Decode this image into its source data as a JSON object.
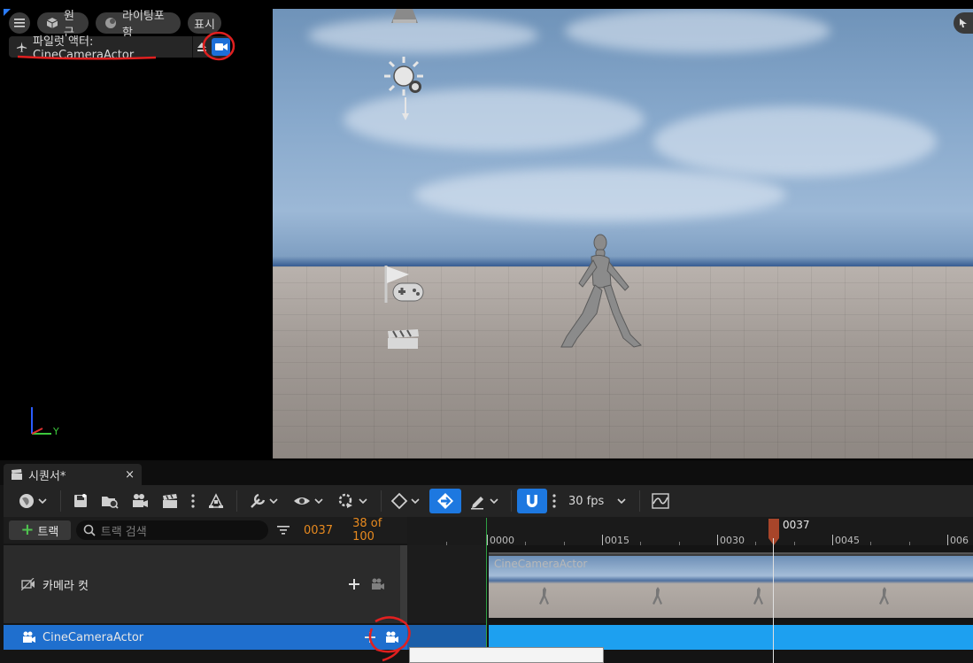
{
  "viewport": {
    "perspective_label": "원근",
    "lighting_label": "라이팅포함",
    "show_label": "표시",
    "pilot_label": "파일럿 액터: CineCameraActor",
    "axis_y_label": "Y"
  },
  "sequencer": {
    "tab_title": "시퀀서*",
    "close_glyph": "×",
    "add_track_label": "트랙",
    "search_placeholder": "트랙 검색",
    "current_frame": "0037",
    "frame_count": "38 of 100",
    "fps_label": "30 fps",
    "playhead_label": "0037",
    "ruler_labels": [
      "0000",
      "0015",
      "0030",
      "0045",
      "006"
    ],
    "tracks": {
      "camera_cut": "카메라 컷",
      "cine_camera": "CineCameraActor",
      "section_label": "CineCameraActor"
    }
  },
  "colors": {
    "accent": "#1d78e0",
    "frame_orange": "#e88a1f",
    "selected_track": "#1f6fce",
    "section_bar": "#1da0f0",
    "annotation_red": "#e02020"
  }
}
